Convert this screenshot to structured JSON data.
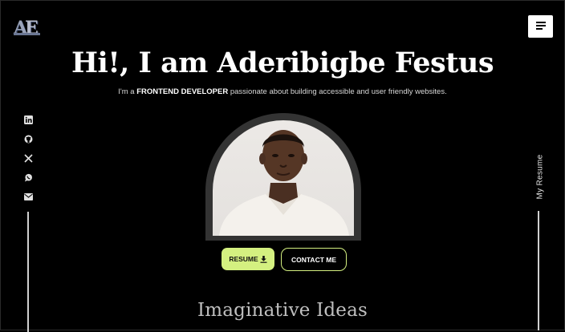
{
  "logo": {
    "letters_a": "A",
    "letters_e": "E"
  },
  "header": {
    "title": "Hi!, I am Aderibigbe Festus",
    "subtitle_prefix": "I'm a ",
    "subtitle_role": "FRONTEND DEVELOPER",
    "subtitle_suffix": " passionate about building accessible and user friendly websites."
  },
  "social": [
    "linkedin-icon",
    "github-icon",
    "x-icon",
    "whatsapp-icon",
    "mail-icon"
  ],
  "side": {
    "resume_label": "My Resume"
  },
  "buttons": {
    "resume_label": "RESUME",
    "contact_label": "CONTACT ME"
  },
  "section": {
    "title": "Imaginative Ideas"
  },
  "colors": {
    "accent": "#d4f080",
    "background": "#000000",
    "arch": "#333333"
  }
}
